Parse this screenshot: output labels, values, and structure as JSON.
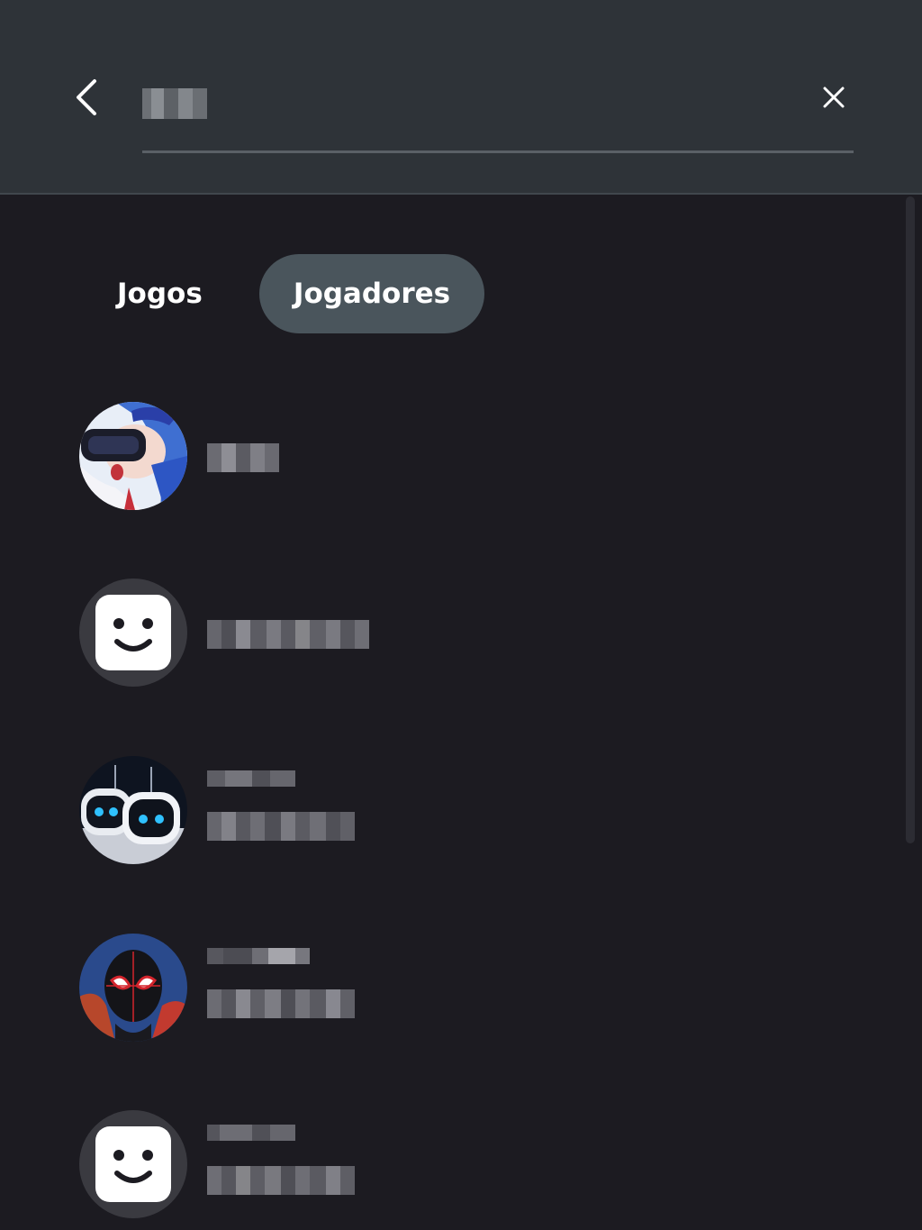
{
  "header": {
    "back_icon": "chevron-left-icon",
    "search_query": "████",
    "clear_icon": "close-icon"
  },
  "tabs": [
    {
      "label": "Jogos",
      "active": false
    },
    {
      "label": "Jogadores",
      "active": true
    }
  ],
  "players": [
    {
      "avatar": "anime-vr-girl-avatar",
      "name": "████",
      "subtitle": ""
    },
    {
      "avatar": "default-smiley-avatar",
      "name": "█████████",
      "subtitle": ""
    },
    {
      "avatar": "astro-bots-avatar",
      "name": "█████",
      "subtitle": "████████"
    },
    {
      "avatar": "miles-morales-avatar",
      "name": "██████",
      "subtitle": "████████"
    },
    {
      "avatar": "default-smiley-avatar",
      "name": "█████",
      "subtitle": "████████"
    }
  ],
  "colors": {
    "background": "#1c1b21",
    "header": "#2e3338",
    "active_tab": "#4a555c",
    "text": "#ffffff"
  }
}
